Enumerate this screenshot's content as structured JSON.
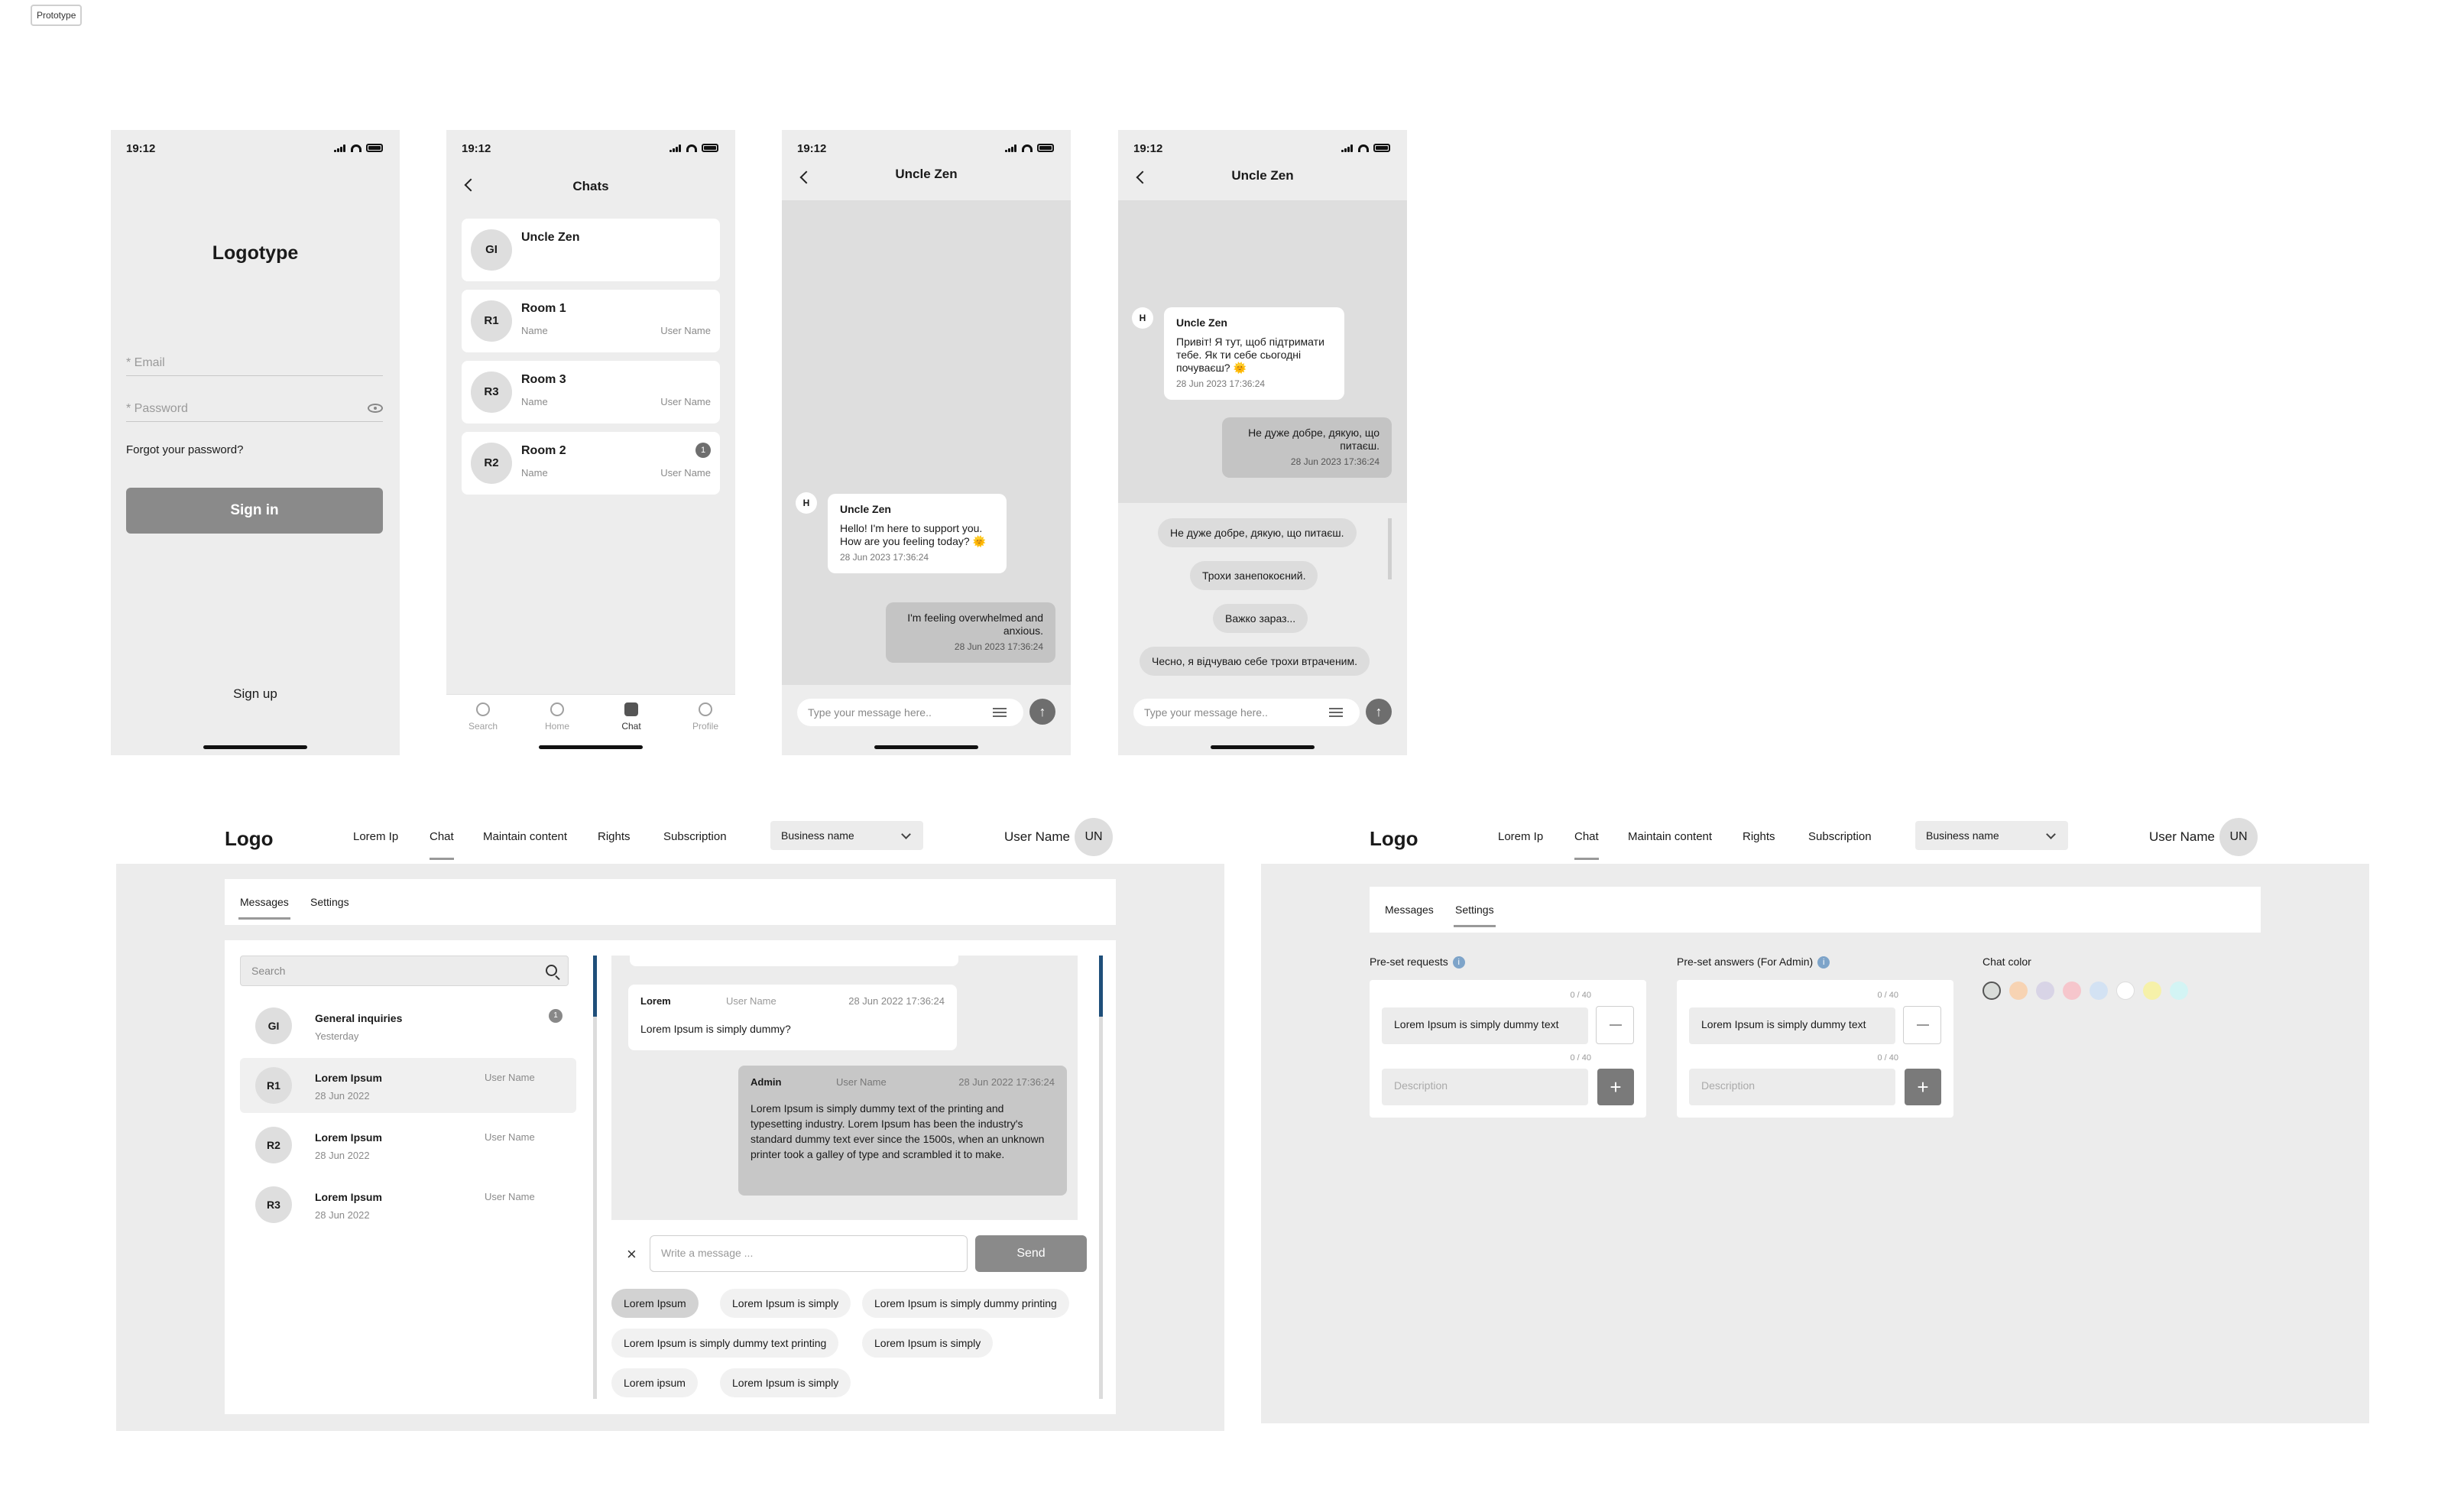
{
  "prototype_tag": "Prototype",
  "status_time": "19:12",
  "login": {
    "logotype": "Logotype",
    "email_placeholder": "* Email",
    "password_placeholder": "* Password",
    "forgot": "Forgot your password?",
    "sign_in": "Sign in",
    "sign_up": "Sign up"
  },
  "chats_screen": {
    "title": "Chats",
    "items": [
      {
        "initials": "GI",
        "name": "Uncle Zen",
        "sub": "",
        "user": "",
        "badge": ""
      },
      {
        "initials": "R1",
        "name": "Room 1",
        "sub": "Name",
        "user": "User Name",
        "badge": ""
      },
      {
        "initials": "R3",
        "name": "Room 3",
        "sub": "Name",
        "user": "User Name",
        "badge": ""
      },
      {
        "initials": "R2",
        "name": "Room 2",
        "sub": "Name",
        "user": "User Name",
        "badge": "1"
      }
    ],
    "tabs": [
      "Search",
      "Home",
      "Chat",
      "Profile"
    ],
    "active_tab": "Chat"
  },
  "chat_screen": {
    "title": "Uncle Zen",
    "in_avatar": "H",
    "in_name": "Uncle Zen",
    "in_text": "Hello! I'm here to support you. How are you feeling today? 🌞",
    "in_time": "28 Jun 2023 17:36:24",
    "out_text": "I'm feeling overwhelmed and anxious.",
    "out_time": "28 Jun 2023 17:36:24",
    "composer_placeholder": "Type your message here..",
    "send_glyph": "↑"
  },
  "chat_screen_ua": {
    "title": "Uncle Zen",
    "in_avatar": "H",
    "in_name": "Uncle Zen",
    "in_text": "Привіт! Я тут, щоб підтримати тебе. Як ти себе сьогодні почуваєш? 🌞",
    "in_time": "28 Jun 2023 17:36:24",
    "out_text": "Не дуже добре, дякую, що питаєш.",
    "out_time": "28 Jun 2023 17:36:24",
    "suggestions": [
      "Не дуже добре, дякую, що питаєш.",
      "Трохи занепокоєний.",
      "Важко зараз...",
      "Чесно, я відчуваю себе трохи втраченим."
    ],
    "composer_placeholder": "Type your message here..",
    "send_glyph": "↑"
  },
  "desktop_nav": {
    "logo": "Logo",
    "items": [
      "Lorem Ip",
      "Chat",
      "Maintain content",
      "Rights",
      "Subscription"
    ],
    "active": "Chat",
    "business_select": "Business name",
    "user_name": "User Name",
    "user_initials": "UN"
  },
  "desktop_messages": {
    "tabs": [
      "Messages",
      "Settings"
    ],
    "active_tab": "Messages",
    "search_placeholder": "Search",
    "conversations": [
      {
        "initials": "GI",
        "name": "General inquiries",
        "date": "Yesterday",
        "user": "",
        "badge": "1"
      },
      {
        "initials": "R1",
        "name": "Lorem Ipsum",
        "date": "28 Jun 2022",
        "user": "User Name",
        "badge": ""
      },
      {
        "initials": "R2",
        "name": "Lorem Ipsum",
        "date": "28 Jun 2022",
        "user": "User Name",
        "badge": ""
      },
      {
        "initials": "R3",
        "name": "Lorem Ipsum",
        "date": "28 Jun 2022",
        "user": "User Name",
        "badge": ""
      }
    ],
    "msg_in": {
      "author": "Lorem",
      "user": "User Name",
      "time": "28 Jun 2022 17:36:24",
      "text": "Lorem Ipsum is simply dummy?"
    },
    "msg_out": {
      "author": "Admin",
      "user": "User Name",
      "time": "28 Jun 2022 17:36:24",
      "text": "Lorem Ipsum is simply dummy text of the printing and typesetting industry. Lorem Ipsum has been the industry's standard dummy text ever since the 1500s, when an unknown printer took a galley of type and scrambled it to make."
    },
    "write_placeholder": "Write a message ...",
    "send_label": "Send",
    "close_glyph": "×",
    "quick_replies": [
      "Lorem Ipsum",
      "Lorem Ipsum is simply",
      "Lorem Ipsum is simply dummy printing",
      "Lorem Ipsum is simply dummy text printing",
      "Lorem Ipsum is simply",
      "Lorem ipsum",
      "Lorem Ipsum is simply"
    ]
  },
  "desktop_settings": {
    "tabs": [
      "Messages",
      "Settings"
    ],
    "active_tab": "Settings",
    "preset_requests_label": "Pre-set requests",
    "preset_answers_label": "Pre-set answers (For Admin)",
    "chat_color_label": "Chat color",
    "info_glyph": "i",
    "counter": "0 / 40",
    "field_value": "Lorem Ipsum is simply dummy text",
    "description_placeholder": "Description",
    "plus_glyph": "+",
    "colors": [
      "#d9dcd9",
      "#f7d3b3",
      "#d8d4e6",
      "#f6c6cc",
      "#d3e2f3",
      "#ffffff",
      "#f6f1a9",
      "#d3f4f4"
    ]
  }
}
